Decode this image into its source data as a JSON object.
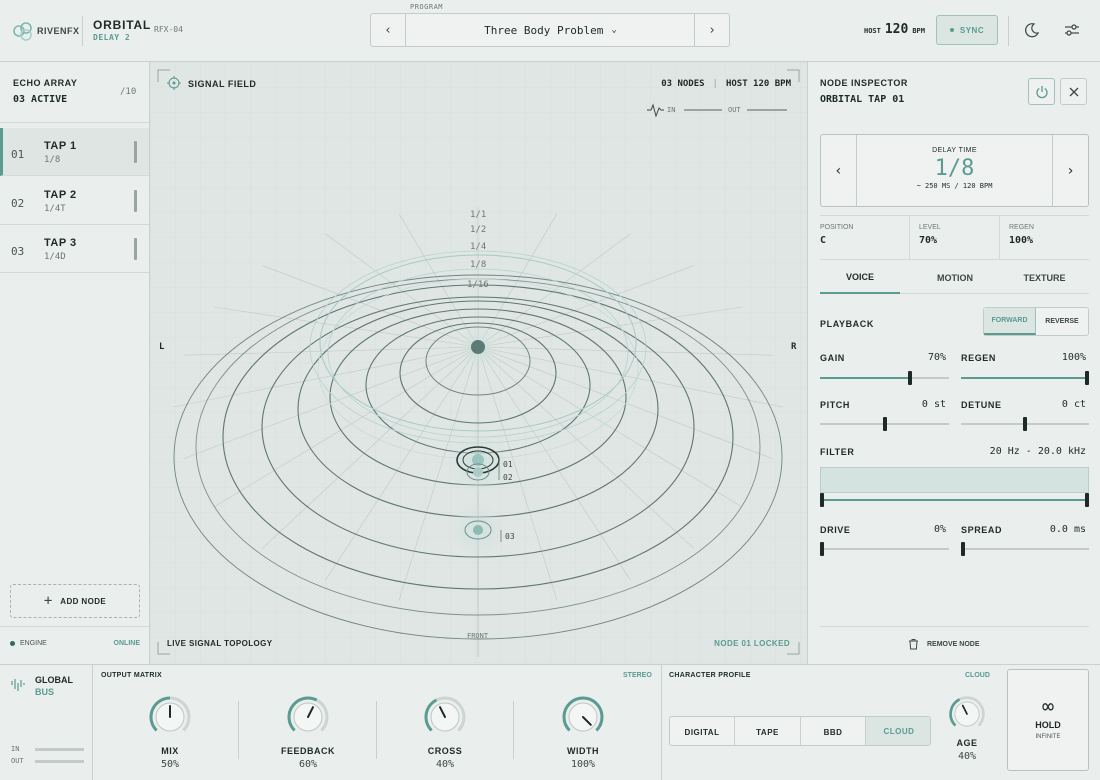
{
  "brand": {
    "logo": "RIVENFX",
    "product": "ORBITAL",
    "subtitle": "DELAY 2",
    "model": "RFX-04"
  },
  "program": {
    "label": "PROGRAM",
    "name": "Three Body Problem"
  },
  "host": {
    "label": "HOST",
    "bpm": "120",
    "unit": "BPM",
    "sync_label": "SYNC"
  },
  "echo_array": {
    "title": "ECHO ARRAY",
    "active": "03 ACTIVE",
    "capacity": "/10",
    "taps": [
      {
        "num": "01",
        "name": "TAP 1",
        "division": "1/8"
      },
      {
        "num": "02",
        "name": "TAP 2",
        "division": "1/4T"
      },
      {
        "num": "03",
        "name": "TAP 3",
        "division": "1/4D"
      }
    ],
    "add_node": "ADD NODE"
  },
  "engine": {
    "label": "ENGINE",
    "status": "ONLINE"
  },
  "signal_field": {
    "title": "SIGNAL FIELD",
    "nodes": "03 NODES",
    "host": "HOST 120 BPM",
    "in_label": "IN",
    "out_label": "OUT",
    "left": "L",
    "right": "R",
    "front": "FRONT",
    "rings": [
      "1/1",
      "1/2",
      "1/4",
      "1/8",
      "1/16"
    ],
    "node_labels": [
      "01",
      "02",
      "03"
    ],
    "footer_left": "LIVE SIGNAL TOPOLOGY",
    "footer_right": "NODE 01 LOCKED"
  },
  "inspector": {
    "title": "NODE INSPECTOR",
    "node": "ORBITAL TAP 01",
    "delay": {
      "label": "DELAY TIME",
      "value": "1/8",
      "detail": "~ 250 MS / 120 BPM"
    },
    "stats": [
      {
        "label": "POSITION",
        "value": "C"
      },
      {
        "label": "LEVEL",
        "value": "70%"
      },
      {
        "label": "REGEN",
        "value": "100%"
      }
    ],
    "tabs": [
      "VOICE",
      "MOTION",
      "TEXTURE"
    ],
    "playback": {
      "label": "PLAYBACK",
      "options": [
        "FORWARD",
        "REVERSE"
      ]
    },
    "params": {
      "gain": {
        "label": "GAIN",
        "value": "70%",
        "level": 0.7
      },
      "regen": {
        "label": "REGEN",
        "value": "100%",
        "level": 1.0
      },
      "pitch": {
        "label": "PITCH",
        "value": "0 st",
        "level": 0.5
      },
      "detune": {
        "label": "DETUNE",
        "value": "0 ct",
        "level": 0.5
      },
      "filter": {
        "label": "FILTER",
        "value": "20 Hz - 20.0 kHz",
        "low": 0.0,
        "high": 1.0
      },
      "drive": {
        "label": "DRIVE",
        "value": "0%",
        "level": 0.0
      },
      "spread": {
        "label": "SPREAD",
        "value": "0.0 ms",
        "level": 0.0
      }
    },
    "remove": "REMOVE NODE"
  },
  "global_bus": {
    "title": "GLOBAL",
    "subtitle": "BUS",
    "in_label": "IN",
    "out_label": "OUT"
  },
  "output_matrix": {
    "title": "OUTPUT MATRIX",
    "mode": "STEREO",
    "knobs": [
      {
        "label": "MIX",
        "value": "50%",
        "level": 0.5
      },
      {
        "label": "FEEDBACK",
        "value": "60%",
        "level": 0.6
      },
      {
        "label": "CROSS",
        "value": "40%",
        "level": 0.4
      },
      {
        "label": "WIDTH",
        "value": "100%",
        "level": 1.0
      }
    ]
  },
  "character": {
    "title": "CHARACTER PROFILE",
    "selected": "CLOUD",
    "options": [
      "DIGITAL",
      "TAPE",
      "BBD",
      "CLOUD"
    ],
    "age": {
      "label": "AGE",
      "value": "40%",
      "level": 0.4
    }
  },
  "hold": {
    "label": "HOLD",
    "sub": "INFINITE"
  },
  "colors": {
    "accent": "#5a9b92",
    "background": "#e7ebe9",
    "ink": "#1f2a28"
  }
}
